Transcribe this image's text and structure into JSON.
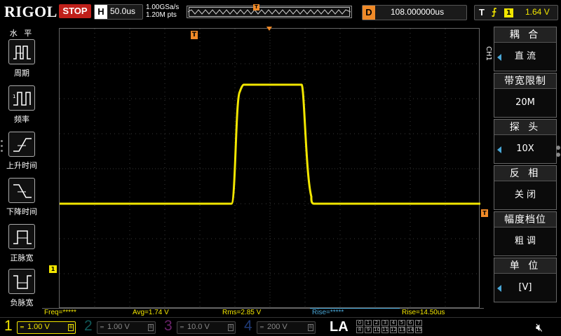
{
  "topbar": {
    "logo": "RIGOL",
    "run_state": "STOP",
    "horizontal": {
      "tag": "H",
      "value": "50.0us"
    },
    "sample_rate": "1.00GSa/s",
    "memory_depth": "1.20M pts",
    "delay": {
      "tag": "D",
      "value": "108.000000us"
    },
    "trigger": {
      "tag": "T",
      "edge_icon": "rising-edge-icon",
      "source": "1",
      "level": "1.64 V"
    }
  },
  "left_menu": {
    "title": "水 平",
    "items": [
      {
        "label": "周期",
        "icon": "period-icon"
      },
      {
        "label": "频率",
        "icon": "frequency-icon"
      },
      {
        "label": "上升时间",
        "icon": "rise-time-icon"
      },
      {
        "label": "下降时间",
        "icon": "fall-time-icon"
      },
      {
        "label": "正脉宽",
        "icon": "positive-width-icon"
      },
      {
        "label": "负脉宽",
        "icon": "negative-width-icon"
      }
    ]
  },
  "markers": {
    "trigger_position": "T",
    "ch1": "1",
    "trigger_level": "T"
  },
  "right_menu": {
    "channel_tab": "CH1",
    "items": [
      {
        "title": "耦 合",
        "value": "直 流",
        "has_arrow": true
      },
      {
        "title": "带宽限制",
        "value": "20M",
        "has_arrow": false
      },
      {
        "title": "探 头",
        "value": "10X",
        "has_arrow": true
      },
      {
        "title": "反 相",
        "value": "关 闭",
        "has_arrow": false
      },
      {
        "title": "幅度档位",
        "value": "粗 调",
        "has_arrow": false
      },
      {
        "title": "单 位",
        "value": "[V]",
        "has_arrow": true
      }
    ]
  },
  "measurements": [
    {
      "text": "Freq=*****",
      "selected": false
    },
    {
      "text": "Avg=1.74 V",
      "selected": false
    },
    {
      "text": "Rms=2.85 V",
      "selected": false
    },
    {
      "text": "Rise=*****",
      "selected": true
    },
    {
      "text": "Rise=14.50us",
      "selected": false
    }
  ],
  "channels": [
    {
      "number": "1",
      "scale": "1.00 V",
      "color": "#f2e600",
      "active": true
    },
    {
      "number": "2",
      "scale": "1.00 V",
      "color": "#1fa0a0",
      "active": false
    },
    {
      "number": "3",
      "scale": "10.0 V",
      "color": "#c040c0",
      "active": false
    },
    {
      "number": "4",
      "scale": "200 V",
      "color": "#3a6ad8",
      "active": false
    }
  ],
  "la": {
    "label": "LA",
    "digital_channels": [
      "0",
      "1",
      "2",
      "3",
      "4",
      "5",
      "6",
      "7",
      "8",
      "9",
      "10",
      "11",
      "12",
      "13",
      "14",
      "15"
    ]
  },
  "speaker_icon": "speaker-muted-icon",
  "waveform": {
    "channel": "CH1",
    "color": "#f2e600",
    "low_level_div": -1.0,
    "high_level_div": 2.4,
    "rise_start_div": -1.1,
    "rise_end_div": -0.75,
    "fall_start_div": 0.9,
    "fall_end_div": 1.25
  }
}
